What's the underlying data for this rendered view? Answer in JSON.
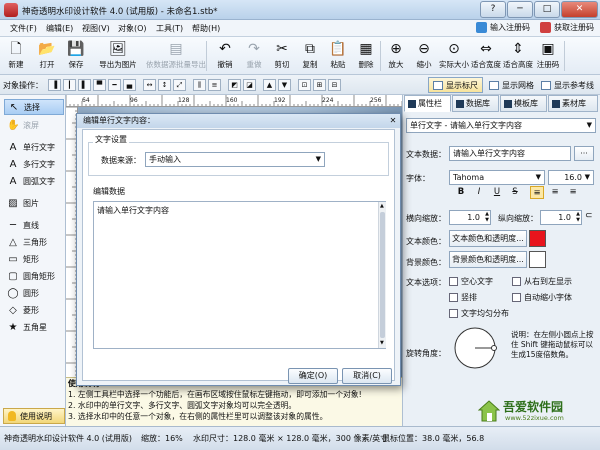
{
  "window": {
    "title": "神奇透明水印设计软件 4.0 (试用版) - 未命名1.stb*",
    "controls": {
      "help": "?",
      "minimize": "─",
      "maximize": "□",
      "close": "✕"
    }
  },
  "menu": {
    "items": [
      "文件(F)",
      "编辑(E)",
      "视图(V)",
      "对象(O)",
      "工具(T)",
      "帮助(H)"
    ],
    "register_label": "输入注册码",
    "get_code_label": "获取注册码"
  },
  "toolbar": {
    "buttons": [
      {
        "label": "新建",
        "glyph": "🗋",
        "icon": "new-file-icon",
        "disabled": false
      },
      {
        "label": "打开",
        "glyph": "📂",
        "icon": "open-folder-icon",
        "disabled": false
      },
      {
        "label": "保存",
        "glyph": "💾",
        "icon": "save-disk-icon",
        "disabled": false
      },
      {
        "label": "导出为图片",
        "glyph": "🖼",
        "icon": "export-image-icon",
        "disabled": false
      },
      {
        "label": "依数据源批量导出",
        "glyph": "▤",
        "icon": "batch-export-icon",
        "disabled": true
      },
      {
        "label": "撤销",
        "glyph": "↶",
        "icon": "undo-icon",
        "disabled": false
      },
      {
        "label": "重做",
        "glyph": "↷",
        "icon": "redo-icon",
        "disabled": true
      },
      {
        "label": "剪切",
        "glyph": "✂",
        "icon": "cut-icon",
        "disabled": false
      },
      {
        "label": "复制",
        "glyph": "⧉",
        "icon": "copy-icon",
        "disabled": false
      },
      {
        "label": "粘贴",
        "glyph": "📋",
        "icon": "paste-icon",
        "disabled": false
      },
      {
        "label": "删除",
        "glyph": "▦",
        "icon": "delete-icon",
        "disabled": false
      },
      {
        "label": "放大",
        "glyph": "⊕",
        "icon": "zoom-in-icon",
        "disabled": false
      },
      {
        "label": "缩小",
        "glyph": "⊖",
        "icon": "zoom-out-icon",
        "disabled": false
      },
      {
        "label": "实际大小",
        "glyph": "⊙",
        "icon": "actual-size-icon",
        "disabled": false
      },
      {
        "label": "适合宽度",
        "glyph": "⇔",
        "icon": "fit-width-icon",
        "disabled": false
      },
      {
        "label": "适合高度",
        "glyph": "⇕",
        "icon": "fit-height-icon",
        "disabled": false
      },
      {
        "label": "注册码",
        "glyph": "▣",
        "icon": "register-code-icon",
        "disabled": false
      }
    ]
  },
  "objbar": {
    "label": "对象操作：",
    "views": [
      {
        "label": "显示标尺",
        "on": true
      },
      {
        "label": "显示网格",
        "on": false
      },
      {
        "label": "显示参考线",
        "on": false
      }
    ]
  },
  "tools": [
    {
      "label": "选择",
      "glyph": "↖",
      "icon": "select-arrow-icon",
      "selected": true,
      "disabled": false
    },
    {
      "label": "滚屏",
      "glyph": "✋",
      "icon": "pan-hand-icon",
      "selected": false,
      "disabled": true
    },
    {
      "label": "单行文字",
      "glyph": "A",
      "icon": "single-line-text-icon",
      "selected": false,
      "disabled": false
    },
    {
      "label": "多行文字",
      "glyph": "A",
      "icon": "multi-line-text-icon",
      "selected": false,
      "disabled": false
    },
    {
      "label": "圆弧文字",
      "glyph": "A",
      "icon": "arc-text-icon",
      "selected": false,
      "disabled": false
    },
    {
      "label": "图片",
      "glyph": "▨",
      "icon": "picture-icon",
      "selected": false,
      "disabled": false
    },
    {
      "label": "直线",
      "glyph": "─",
      "icon": "line-icon",
      "selected": false,
      "disabled": false
    },
    {
      "label": "三角形",
      "glyph": "△",
      "icon": "triangle-icon",
      "selected": false,
      "disabled": false
    },
    {
      "label": "矩形",
      "glyph": "▭",
      "icon": "rectangle-icon",
      "selected": false,
      "disabled": false
    },
    {
      "label": "圆角矩形",
      "glyph": "▢",
      "icon": "rounded-rectangle-icon",
      "selected": false,
      "disabled": false
    },
    {
      "label": "圆形",
      "glyph": "◯",
      "icon": "circle-icon",
      "selected": false,
      "disabled": false
    },
    {
      "label": "菱形",
      "glyph": "◇",
      "icon": "diamond-icon",
      "selected": false,
      "disabled": false
    },
    {
      "label": "五角星",
      "glyph": "★",
      "icon": "star-icon",
      "selected": false,
      "disabled": false
    }
  ],
  "help_tab_label": "使用说明",
  "help_text": [
    "使用说明",
    "1. 左侧工具栏中选择一个功能后，在画布区域按住鼠标左键拖动，即可添加一个对象!",
    "2. 水印中的单行文字、多行文字、圆弧文字对象均可以完全透明。",
    "3. 选择水印中的任意一个对象，在右侧的属性栏里可以调整该对象的属性。"
  ],
  "ruler_numbers": [
    "64",
    "96",
    "128",
    "160",
    "192",
    "224",
    "256"
  ],
  "dialog": {
    "title": "编辑单行文字内容：",
    "close": "✕",
    "group1_title": "文字设置",
    "source_label": "数据来源：",
    "source_value": "手动输入",
    "group2_title": "编辑数据",
    "text_value": "请输入单行文字内容",
    "ok_label": "确定(O)",
    "cancel_label": "取消(C)"
  },
  "right_panel": {
    "tabs": [
      "属性栏",
      "数据库",
      "模板库",
      "素材库"
    ],
    "object_type": "单行文字 - 请输入单行文字内容",
    "text_data_label": "文本数据：",
    "text_data_value": "请输入单行文字内容",
    "font_label": "字体：",
    "font_value": "Tahoma",
    "font_size": "16.0",
    "format_buttons": [
      "B",
      "I",
      "U",
      "S"
    ],
    "hscale_label": "横向缩放：",
    "hscale_value": "1.0",
    "vscale_label": "纵向缩放：",
    "vscale_value": "1.0",
    "text_color_label": "文本颜色：",
    "text_color_btn": "文本颜色和透明度...",
    "text_color": "#e8141c",
    "bg_color_label": "背景颜色：",
    "bg_color_btn": "背景颜色和透明度...",
    "bg_color": "#ffffff",
    "options_label": "文本选项：",
    "options": [
      "空心文字",
      "从右到左显示",
      "竖排",
      "自动缩小字体",
      "文字均匀分布"
    ],
    "rotate_label": "旋转角度：",
    "rotate_note": "说明：在左侧小圆点上按住 Shift 键拖动鼠标可以生成15度倍数角。"
  },
  "status": {
    "app": "神奇透明水印设计软件 4.0 (试用版)",
    "zoom": "缩放：16%",
    "size": "水印尺寸：128.0 毫米 × 128.0 毫米，300 像素/英寸",
    "mouse": "鼠标位置：38.0 毫米，56.8"
  },
  "watermark": {
    "main": "吾爱软件园",
    "url": "www.52zixue.com"
  }
}
